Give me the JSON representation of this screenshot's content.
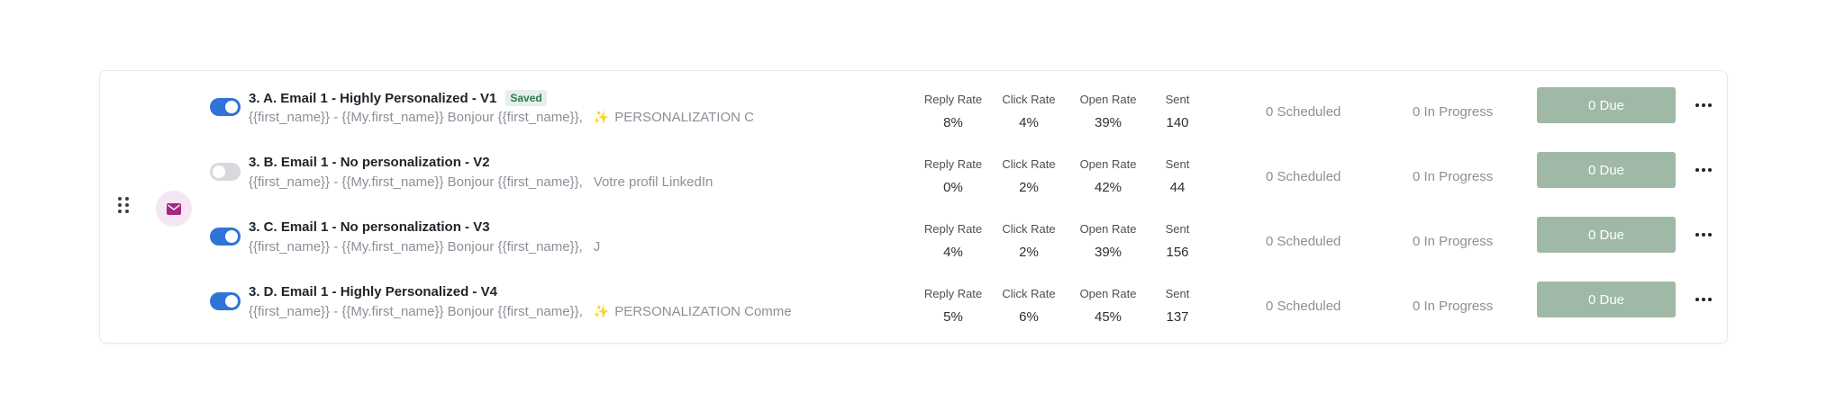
{
  "steps": [
    {
      "title": "3. A. Email 1 - Highly Personalized - V1",
      "badge": "Saved",
      "toggle_on": true,
      "subject_part1": "{{first_name}} - {{My.first_name}} Bonjour {{first_name}},",
      "sparkle": "✨",
      "subject_part2": "PERSONALIZATION   C",
      "reply_rate": "8%",
      "click_rate": "4%",
      "open_rate": "39%",
      "sent": "140"
    },
    {
      "title": "3. B. Email 1 - No personalization - V2",
      "badge": "",
      "toggle_on": false,
      "subject_part1": "{{first_name}} - {{My.first_name}} Bonjour {{first_name}},",
      "sparkle": "",
      "subject_part2": "Votre profil LinkedIn",
      "reply_rate": "0%",
      "click_rate": "2%",
      "open_rate": "42%",
      "sent": "44"
    },
    {
      "title": "3. C. Email 1 - No personalization - V3",
      "badge": "",
      "toggle_on": true,
      "subject_part1": "{{first_name}} - {{My.first_name}} Bonjour {{first_name}},",
      "sparkle": "",
      "subject_part2": "J",
      "reply_rate": "4%",
      "click_rate": "2%",
      "open_rate": "39%",
      "sent": "156"
    },
    {
      "title": "3. D. Email 1 - Highly Personalized - V4",
      "badge": "",
      "toggle_on": true,
      "subject_part1": "{{first_name}} - {{My.first_name}} Bonjour {{first_name}},",
      "sparkle": "✨",
      "subject_part2": "PERSONALIZATION Comme",
      "reply_rate": "5%",
      "click_rate": "6%",
      "open_rate": "45%",
      "sent": "137"
    }
  ],
  "labels": {
    "reply_rate": "Reply Rate",
    "click_rate": "Click Rate",
    "open_rate": "Open Rate",
    "sent": "Sent",
    "scheduled": "0 Scheduled",
    "in_progress": "0 In Progress",
    "due": "0 Due"
  },
  "icons": {
    "drag": "drag-handle-icon",
    "step": "envelope-icon",
    "more": "more-horizontal-icon"
  },
  "colors": {
    "toggle_on": "#2f74d6",
    "toggle_off": "#d7d9dc",
    "due_button": "#9fb9a6",
    "saved_badge_bg": "#e5f0ea",
    "saved_badge_text": "#2f7a4e",
    "email_icon": "#a3287f",
    "sparkle": "#e9b73a"
  }
}
